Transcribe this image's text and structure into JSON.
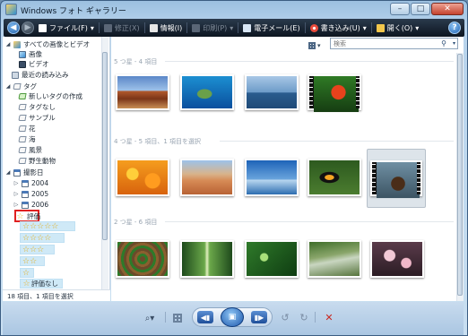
{
  "window": {
    "title": "Windows フォト ギャラリー"
  },
  "title_buttons": {
    "minimize": "–",
    "maximize": "□",
    "close": "✕"
  },
  "toolbar": {
    "file": "ファイル(F)",
    "fix": "修正(X)",
    "info": "情報(I)",
    "print": "印刷(P)",
    "email": "電子メール(E)",
    "burn": "書き込み(U)",
    "open": "開く(O)",
    "help": "?"
  },
  "sidebar": {
    "all": "すべての画像とビデオ",
    "images": "画像",
    "video": "ビデオ",
    "recent_import": "最近の読み込み",
    "tags": "タグ",
    "create_tag": "新しいタグの作成",
    "no_tag": "タグなし",
    "sample": "サンプル",
    "flower": "花",
    "sea": "海",
    "landscape": "風景",
    "wild": "野生動物",
    "date_taken": "撮影日",
    "y2004": "2004",
    "y2005": "2005",
    "y2006": "2006",
    "rating": "評価",
    "no_rating": "評価なし"
  },
  "status": {
    "text": "18 項目、1 項目を選択"
  },
  "view": {
    "label": "▾"
  },
  "search": {
    "placeholder": "検索"
  },
  "groups": [
    {
      "header": "5 つ星 - 4 項目"
    },
    {
      "header": "4 つ星 - 5 項目、1 項目を選択"
    },
    {
      "header": "2 つ星 - 6 項目"
    }
  ],
  "controls": {
    "zoom": "⌕▾",
    "prev": "◀▮",
    "slideshow": "▣",
    "next": "▮▶",
    "rotate_left": "↺",
    "rotate_right": "↻",
    "delete": "✕"
  },
  "colors": {
    "accent": "#1f5ea8",
    "highlight": "#e02020",
    "toolbar": "#0d1520"
  }
}
